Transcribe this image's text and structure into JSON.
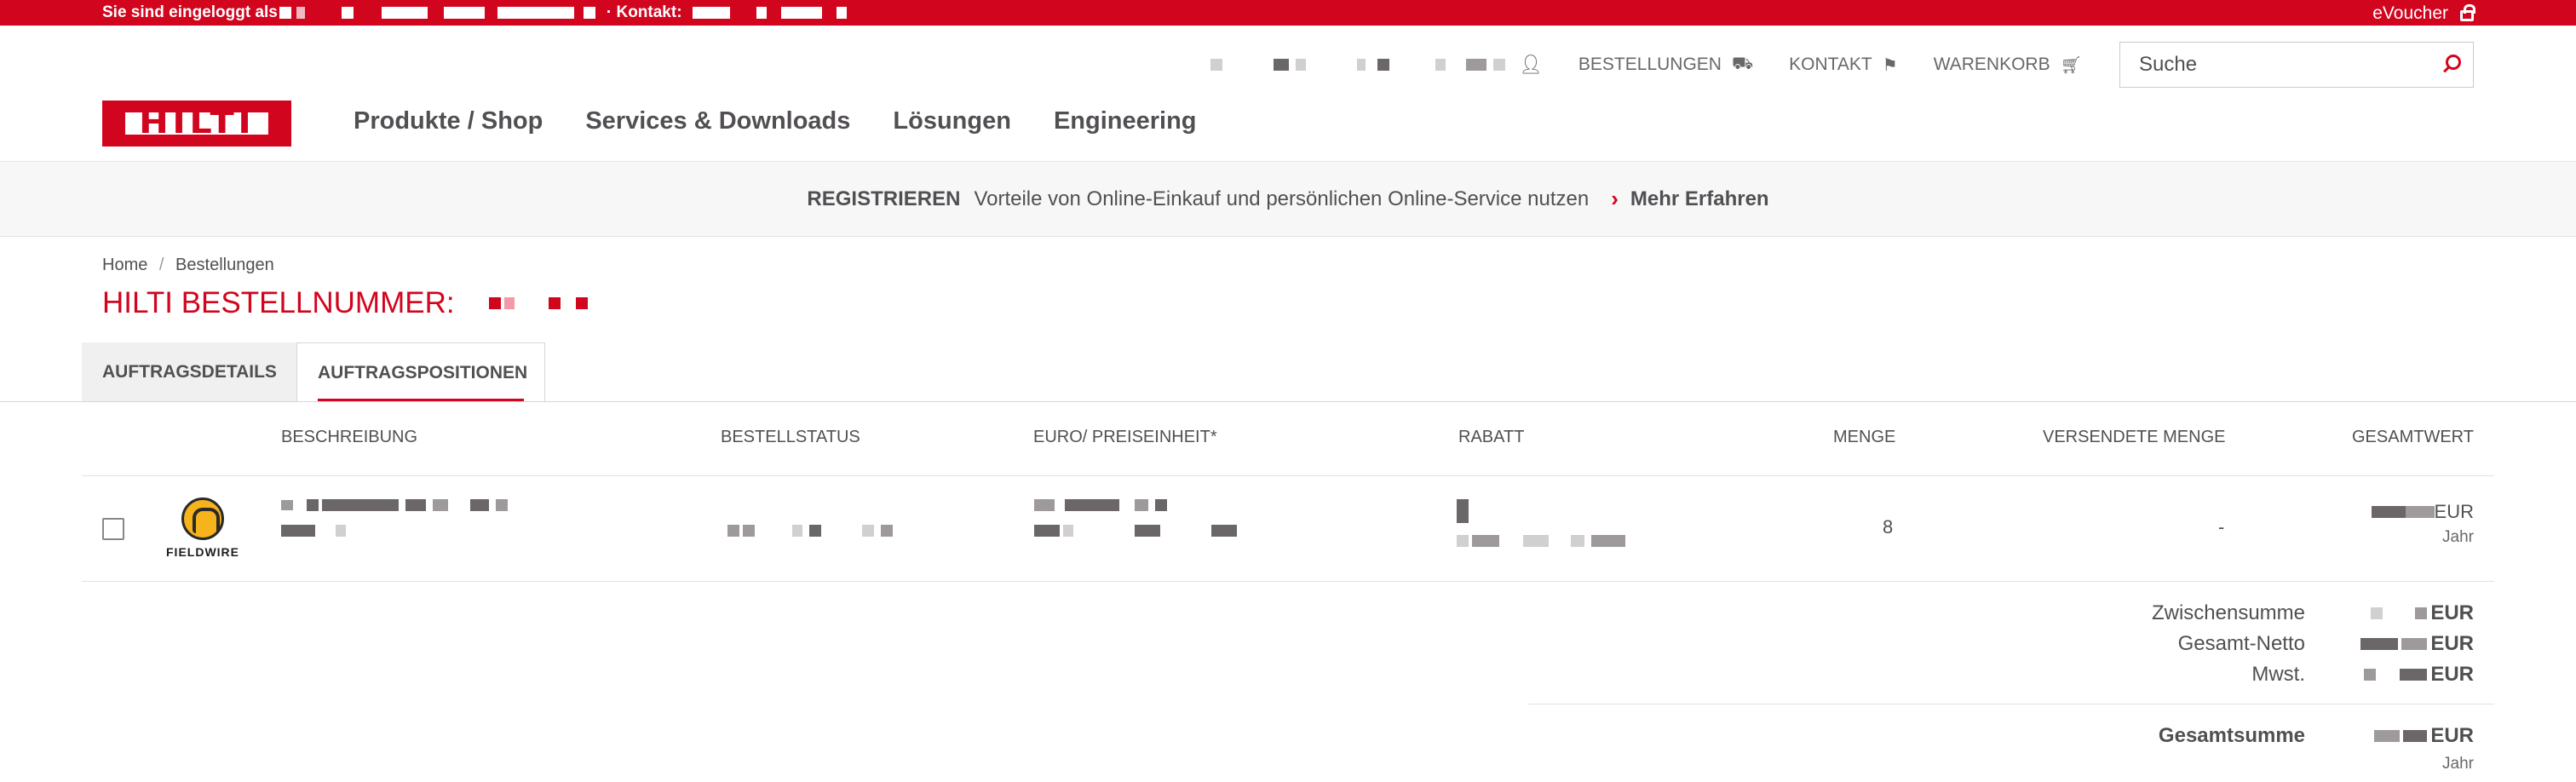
{
  "topbar": {
    "logged_in_label": "Sie sind eingeloggt als",
    "contact_label": "· Kontakt:",
    "evoucher_label": "eVoucher"
  },
  "header": {
    "util": {
      "orders_label": "BESTELLUNGEN",
      "contact_label": "KONTAKT",
      "cart_label": "WARENKORB",
      "search_placeholder": "Suche"
    },
    "logo_text": "HILTI",
    "nav": [
      "Produkte / Shop",
      "Services & Downloads",
      "Lösungen",
      "Engineering"
    ]
  },
  "banner": {
    "register": "REGISTRIEREN",
    "text": "Vorteile von Online-Einkauf und persönlichen Online-Service nutzen",
    "more": "Mehr Erfahren"
  },
  "breadcrumb": [
    "Home",
    "Bestellungen"
  ],
  "order_title": "HILTI BESTELLNUMMER:",
  "tabs": {
    "details": "AUFTRAGSDETAILS",
    "positions": "AUFTRAGSPOSITIONEN"
  },
  "table": {
    "headers": {
      "description": "BESCHREIBUNG",
      "status": "BESTELLSTATUS",
      "unit_price": "EURO/ PREISEINHEIT*",
      "discount": "RABATT",
      "quantity": "MENGE",
      "shipped": "VERSENDETE MENGE",
      "total": "GESAMTWERT"
    },
    "rows": [
      {
        "brand": "FIELDWIRE",
        "quantity": "8",
        "shipped": "-",
        "currency": "EUR",
        "period": "Jahr"
      }
    ]
  },
  "totals": {
    "subtotal_label": "Zwischensumme",
    "net_label": "Gesamt-Netto",
    "vat_label": "Mwst.",
    "grand_label": "Gesamtsumme",
    "currency": "EUR",
    "period": "Jahr"
  },
  "colors": {
    "brand_red": "#d2051e",
    "text": "#524f53",
    "icon_yellow": "#f6b31b"
  },
  "icons": [
    "lock-icon",
    "user-icon",
    "truck-icon",
    "flag-icon",
    "cart-icon",
    "search-icon",
    "chevron-right-icon",
    "fieldwire-logo"
  ]
}
